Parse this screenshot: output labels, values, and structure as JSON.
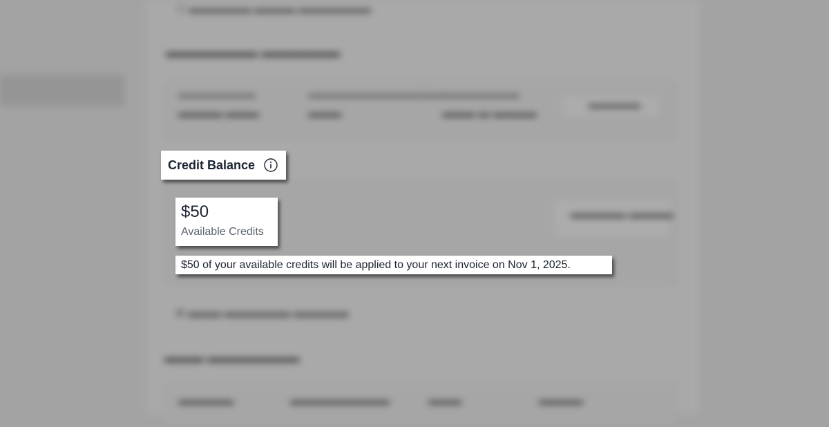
{
  "credit_balance": {
    "heading": "Credit Balance",
    "info_icon": "info-circle-icon",
    "amount": "$50",
    "amount_label": "Available Credits",
    "note": "$50 of your available credits will be applied to your next invoice on Nov 1, 2025."
  },
  "colors": {
    "heading_text": "#1b2330",
    "secondary_text": "#5c6470",
    "callout_background": "#ffffff",
    "backdrop": "#a3a3a3"
  }
}
